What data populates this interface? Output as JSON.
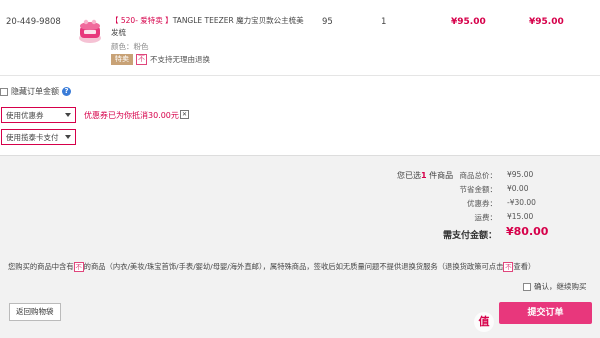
{
  "order_item": {
    "order_no": "20-449-9808",
    "title_promo": "【 520- 爱特卖 】",
    "title_rest": "TANGLE TEEZER 魔力宝贝款公主梳美发梳",
    "color_label": "颜色：粉色",
    "sale_tag": "特卖",
    "no_return_tag": "不",
    "no_return_text": "不支持无理由退换",
    "unit_price": "95",
    "quantity": "1",
    "price": "¥95.00",
    "subtotal": "¥95.00"
  },
  "options": {
    "hide_amount_label": "隐藏订单金额",
    "help_icon": "?",
    "coupon_select": "使用优惠券",
    "coupon_message": "优惠券已为你抵消30.00元",
    "coupon_close": "✕",
    "payment_select": "使用揽泰卡支付"
  },
  "summary": {
    "selected_prefix": "您已选",
    "selected_count": "1",
    "selected_suffix": "件商品",
    "rows": [
      {
        "label": "商品总价：",
        "value": "¥95.00"
      },
      {
        "label": "节省金额：",
        "value": "¥0.00"
      },
      {
        "label": "优惠券：",
        "value": "-¥30.00"
      },
      {
        "label": "运费：",
        "value": "¥15.00"
      }
    ],
    "pay_label": "需支付金额：",
    "pay_value": "¥80.00"
  },
  "notice": {
    "part1": "您购买的商品中含有",
    "tag": "不",
    "part2": "的商品（内衣/美妆/珠宝首饰/手表/婴幼/母婴/海外直邮），属特殊商品，签收后如无质量问题不提供退换货服务（退换货政策可点击",
    "part3": "查看）"
  },
  "confirm_label": "确认，继续购买",
  "back_button": "返回购物袋",
  "submit_button": "提交订单",
  "colors": {
    "accent": "#d6004a",
    "button": "#e8377c",
    "summary_bg": "#f2f2f2"
  }
}
